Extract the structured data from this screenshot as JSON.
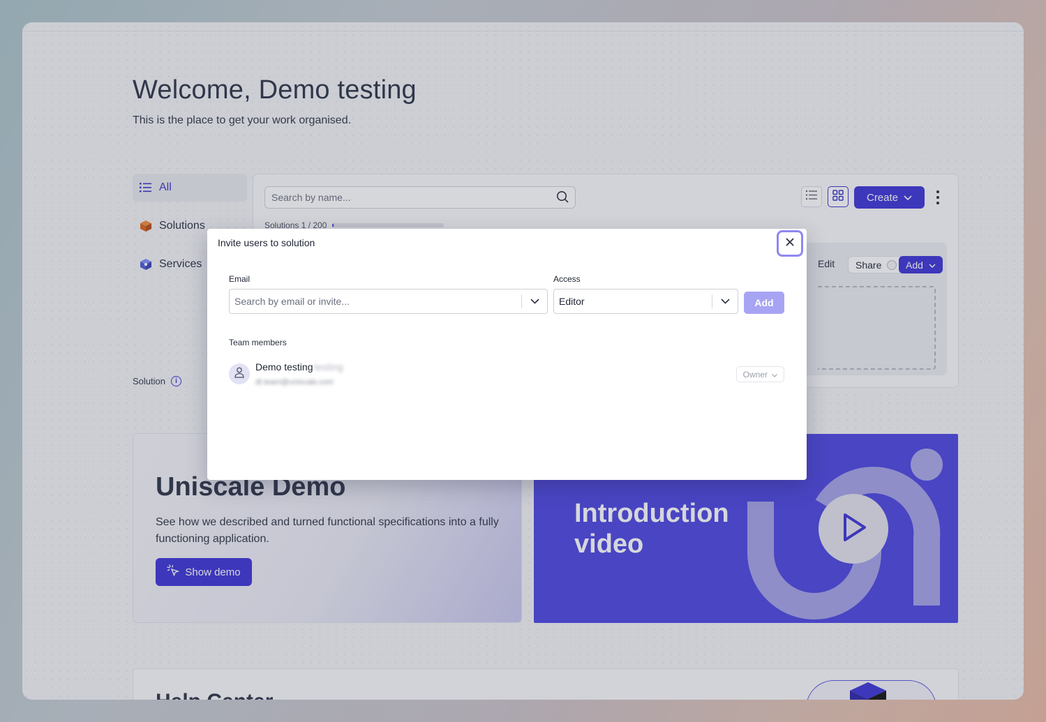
{
  "welcome": {
    "title": "Welcome, Demo testing",
    "subtitle": "This is the place to get your work organised."
  },
  "sidebar": {
    "items": [
      {
        "label": "All",
        "icon": "list-icon",
        "active": true
      },
      {
        "label": "Solutions",
        "icon": "solutions-cube-icon"
      },
      {
        "label": "Services",
        "icon": "services-cube-icon"
      }
    ],
    "solution_label": "Solution"
  },
  "toolbar": {
    "search_placeholder": "Search by name...",
    "create_label": "Create",
    "solutions_count": "Solutions 1 / 200",
    "solutions_usage": 0.005
  },
  "card": {
    "edit_label": "Edit",
    "share_label": "Share",
    "add_label": "Add"
  },
  "demo": {
    "title": "Uniscale Demo",
    "description": "See how we described and turned functional specifications into a fully functioning application.",
    "button_label": "Show demo"
  },
  "video": {
    "title": "Introduction video"
  },
  "help": {
    "title": "Help Center"
  },
  "modal": {
    "title": "Invite users to solution",
    "email_label": "Email",
    "email_placeholder": "Search by email or invite...",
    "access_label": "Access",
    "access_value": "Editor",
    "add_label": "Add",
    "team_label": "Team members",
    "members": [
      {
        "name": "Demo testing",
        "name_suffix": "testing",
        "email": "dt.team@uniscale.com",
        "role": "Owner"
      }
    ]
  },
  "colors": {
    "accent": "#3b33d6",
    "accent_light": "#a8a4f4",
    "video_bg": "#4b44e0"
  }
}
